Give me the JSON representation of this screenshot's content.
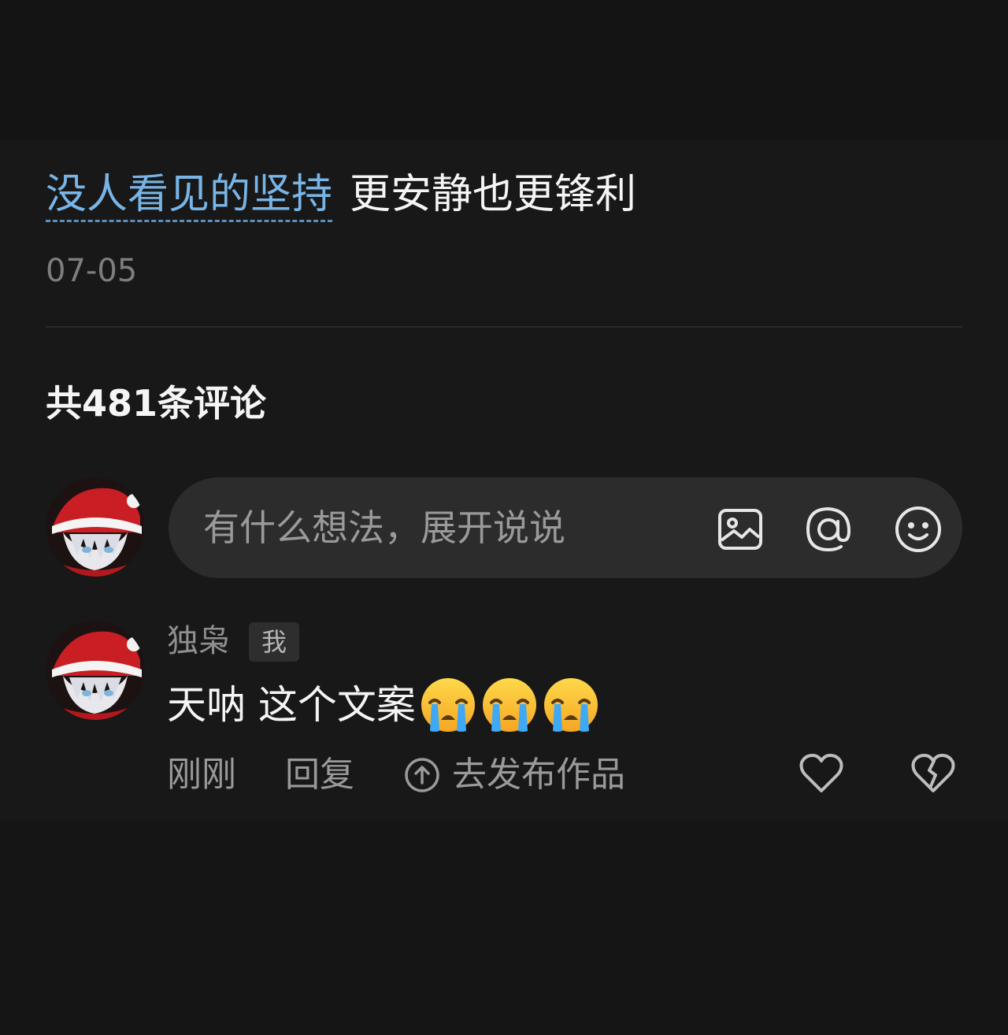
{
  "post": {
    "topic": "没人看见的坚持",
    "text": "更安静也更锋利",
    "date": "07-05"
  },
  "comments_header": {
    "count_label": "共481条评论"
  },
  "composer": {
    "placeholder": "有什么想法，展开说说",
    "icons": [
      "image-icon",
      "at-icon",
      "emoji-icon"
    ]
  },
  "comment": {
    "username": "独枭",
    "badge": "我",
    "text": "天呐 这个文案",
    "emojis": [
      "loudly-crying-emoji",
      "loudly-crying-emoji",
      "loudly-crying-emoji"
    ],
    "time": "刚刚",
    "reply_label": "回复",
    "post_works_label": "去发布作品"
  },
  "colors": {
    "background": "#181818",
    "topic_link": "#79b4e6",
    "muted_text": "#9a9a9a",
    "composer_bg": "#2c2c2c"
  }
}
